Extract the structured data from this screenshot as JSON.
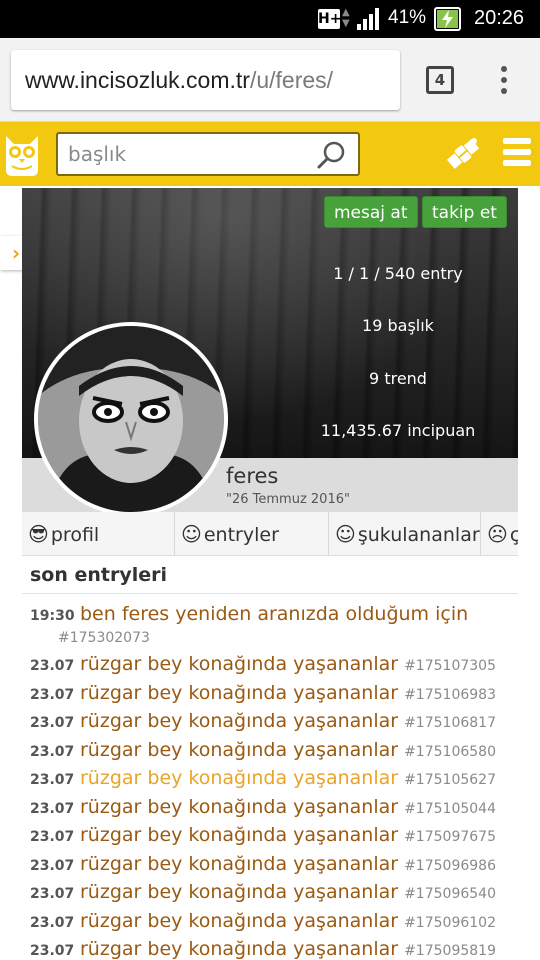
{
  "status_bar": {
    "network": "H+",
    "battery_percent": "41%",
    "battery_level": 0.41,
    "time": "20:26",
    "icons": [
      "hplus-network-icon",
      "signal-icon",
      "battery-charging-icon"
    ]
  },
  "browser": {
    "url_host": "www.incisozluk.com.tr",
    "url_path": "/u/feres/",
    "tab_count": "4"
  },
  "header": {
    "search_placeholder": "başlık",
    "colors": {
      "brand_yellow": "#f2c811",
      "green_button": "#47a23c",
      "link_brown": "#9a5a12",
      "link_highlight": "#e8a428"
    }
  },
  "profile": {
    "message_button": "mesaj at",
    "follow_button": "takip et",
    "stats": {
      "entries": "1 / 1 / 540 entry",
      "topics": "19 başlık",
      "trends": "9 trend",
      "points": "11,435.67 incipuan"
    },
    "username": "feres",
    "join_date": "\"26 Temmuz 2016\"",
    "tabs": [
      {
        "icon": "😎",
        "label": "profil"
      },
      {
        "icon": "☺",
        "label": "entryler"
      },
      {
        "icon": "☺",
        "label": "şukulananlar"
      },
      {
        "icon": "☹",
        "label": "ç"
      }
    ]
  },
  "recent": {
    "title": "son entryleri",
    "first": {
      "time": "19:30",
      "title": "ben feres yeniden aranızda olduğum için",
      "id": "#175302073"
    },
    "items": [
      {
        "time": "23.07",
        "title": "rüzgar bey konağında yaşananlar",
        "id": "#175107305"
      },
      {
        "time": "23.07",
        "title": "rüzgar bey konağında yaşananlar",
        "id": "#175106983"
      },
      {
        "time": "23.07",
        "title": "rüzgar bey konağında yaşananlar",
        "id": "#175106817"
      },
      {
        "time": "23.07",
        "title": "rüzgar bey konağında yaşananlar",
        "id": "#175106580"
      },
      {
        "time": "23.07",
        "title": "rüzgar bey konağında yaşananlar",
        "id": "#175105627"
      },
      {
        "time": "23.07",
        "title": "rüzgar bey konağında yaşananlar",
        "id": "#175105044"
      },
      {
        "time": "23.07",
        "title": "rüzgar bey konağında yaşananlar",
        "id": "#175097675"
      },
      {
        "time": "23.07",
        "title": "rüzgar bey konağında yaşananlar",
        "id": "#175096986"
      },
      {
        "time": "23.07",
        "title": "rüzgar bey konağında yaşananlar",
        "id": "#175096540"
      },
      {
        "time": "23.07",
        "title": "rüzgar bey konağında yaşananlar",
        "id": "#175096102"
      },
      {
        "time": "23.07",
        "title": "rüzgar bey konağında yaşananlar",
        "id": "#175095819"
      }
    ],
    "highlighted_item": 4
  }
}
